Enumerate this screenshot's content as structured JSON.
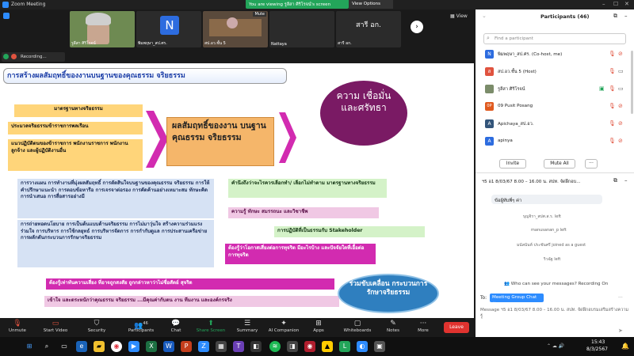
{
  "window": {
    "title": "Zoom Meeting",
    "viewing_banner": "You are viewing รูลีสา ศิริโรจน์'s screen",
    "view_options": "View Options"
  },
  "thumbnails": [
    {
      "name": "รูลีสา ศิริโรจน์",
      "type": "video"
    },
    {
      "name": "พิมพฤษา_สป.ศร.",
      "initial": "N",
      "type": "initial"
    },
    {
      "name": "สป.อว.ชั้น 5",
      "type": "video",
      "badge": "Mute"
    },
    {
      "name": "Nattaya",
      "type": "blank"
    },
    {
      "name": "สารี อก.",
      "initial": "สารี อก.",
      "type": "initial"
    }
  ],
  "view_button": "View",
  "recording": {
    "label": "Recording..."
  },
  "slide": {
    "title": "การสร้างผลสัมฤทธิ์ของงานบนฐานของคุณธรรม จริยธรรม",
    "left_labels": [
      "มาตรฐานทางจริยธรรม",
      "ประมวลจริยธรรมข้าราชการพลเรือน",
      "แนวปฏิบัติตนของข้าราชการ พนักงานราชการ พนักงาน ลูกจ้าง และผู้ปฏิบัติงานอื่น"
    ],
    "center_label": "ผลสัมฤทธิ์ของงาน บนฐานคุณธรรม จริยธรรม",
    "trust_label": "ความ เชื่อมั่น และศรัทธา",
    "blue_box_1": "การวางแผน การทำงานที่มุ่งผลสัมฤทธิ์ การตัดสินใจบนฐานของคุณธรรม จริยธรรม การให้คำปรึกษาแนะนำ การตอบข้อหารือ การเจรจาต่อรอง การคัดค้านอย่างเหมาะสม ทักษะคิด การนำเสนอ การสื่อสารอย่างมี",
    "blue_box_2": "การถ่ายทอดนโยบาย การเป็นต้นแบบด้านจริยธรรม การไม่มาวุ่นใจ สร้างความร่วมแรงร่วมใจ การบริหาร การใช้กลยุทธ์ การบริหารจัดการ การกำกับดูแล การประสานเครือข่าย การผลักดันกระบวนการรักษาจริยธรรม",
    "right_1": "คำนึงถึงว่าจะไรควรเลือกทำ/ เลือกไม่ทำตาม มาตรฐานทางจริยธรรม",
    "right_2": "ความรู้ ทักษะ สมรรถนะ และวิชาชีพ",
    "right_3": "การปฏิบัติที่เป็นธรรมกับ Stakeholder",
    "right_4": "ต้องรู้ว่าโอกาสเสี่ยงต่อการทุจริต มีอะไรบ้าง และปัจจัยใดที่เอื้อต่อการทุจริต",
    "pink_1": "ต้องรู้เท่าทันความเสี่ยง ที่อาจถูกสงสัย ถูกกล่าวหาว่าไม่ซื่อสัตย์ สุจริต",
    "pink_2": "เข้าใจ และตระหนักว่าคุณธรรม จริยธรรม ...มีคุณค่ากับตน งาน ทีมงาน และองค์กรจริง",
    "oval": "ร่วมขับเคลื่อน กระบวนการ รักษาจริยธรรม"
  },
  "participants": {
    "header": "Participants (46)",
    "search_placeholder": "Find a participant",
    "list": [
      {
        "initial": "N",
        "name": "พิมพฤษา_สป.ศร. (Co-host, me)",
        "color": "#2d6cdf"
      },
      {
        "initial": "ส",
        "name": "สป.อว.ชั้น 5 (Host)",
        "color": "#e0533f"
      },
      {
        "initial": "",
        "name": "รูลีสา ศิริโรจน์",
        "color": "#7b8c6a"
      },
      {
        "initial": "0P",
        "name": "09 Pusit Posang",
        "color": "#e05a1f"
      },
      {
        "initial": "A",
        "name": "Apichaya_สป.อว.",
        "color": "#33557a"
      },
      {
        "initial": "A",
        "name": "apinya",
        "color": "#2d6cdf"
      }
    ],
    "invite": "Invite",
    "mute_all": "Mute All"
  },
  "chat": {
    "header": "ฯ5 อ1 8/03/67 8.00 – 16.00 น. สปท. จัดฝึกอบ...",
    "bubble": "ข้อผู้ทับพี่ๆ ค่า",
    "system_msgs": [
      "บุญจิรา_สปศ.ส.ร. left",
      "manusanan_p left",
      "มนัสนันท์ ประชันศรี joined as a guest",
      "ริวฉัฐ left"
    ],
    "privacy": "Who can see your messages? Recording On",
    "to_label": "To:",
    "to_value": "Meeting Group Chat",
    "input_placeholder": "Message ฯ5 อ1 8/03/67 8.00 – 16.00 น. สปท. จัดฝึกอบรมเสริมสร้างความรู้"
  },
  "toolbar": {
    "unmute": "Unmute",
    "start_video": "Start Video",
    "security": "Security",
    "participants": "Participants",
    "participants_count": "46",
    "chat": "Chat",
    "share_screen": "Share Screen",
    "summary": "Summary",
    "ai_companion": "AI Companion",
    "apps": "Apps",
    "whiteboards": "Whiteboards",
    "notes": "Notes",
    "more": "More",
    "leave": "Leave"
  },
  "taskbar": {
    "time": "15:43",
    "date": "8/3/2567"
  }
}
